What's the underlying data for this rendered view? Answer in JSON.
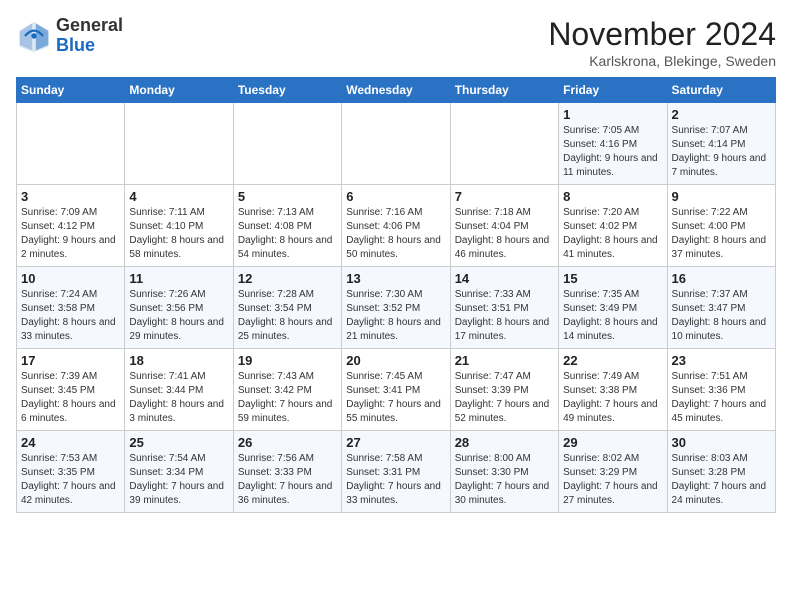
{
  "header": {
    "logo_general": "General",
    "logo_blue": "Blue",
    "title": "November 2024",
    "location": "Karlskrona, Blekinge, Sweden"
  },
  "days_of_week": [
    "Sunday",
    "Monday",
    "Tuesday",
    "Wednesday",
    "Thursday",
    "Friday",
    "Saturday"
  ],
  "weeks": [
    [
      {
        "day": "",
        "info": ""
      },
      {
        "day": "",
        "info": ""
      },
      {
        "day": "",
        "info": ""
      },
      {
        "day": "",
        "info": ""
      },
      {
        "day": "",
        "info": ""
      },
      {
        "day": "1",
        "info": "Sunrise: 7:05 AM\nSunset: 4:16 PM\nDaylight: 9 hours and 11 minutes."
      },
      {
        "day": "2",
        "info": "Sunrise: 7:07 AM\nSunset: 4:14 PM\nDaylight: 9 hours and 7 minutes."
      }
    ],
    [
      {
        "day": "3",
        "info": "Sunrise: 7:09 AM\nSunset: 4:12 PM\nDaylight: 9 hours and 2 minutes."
      },
      {
        "day": "4",
        "info": "Sunrise: 7:11 AM\nSunset: 4:10 PM\nDaylight: 8 hours and 58 minutes."
      },
      {
        "day": "5",
        "info": "Sunrise: 7:13 AM\nSunset: 4:08 PM\nDaylight: 8 hours and 54 minutes."
      },
      {
        "day": "6",
        "info": "Sunrise: 7:16 AM\nSunset: 4:06 PM\nDaylight: 8 hours and 50 minutes."
      },
      {
        "day": "7",
        "info": "Sunrise: 7:18 AM\nSunset: 4:04 PM\nDaylight: 8 hours and 46 minutes."
      },
      {
        "day": "8",
        "info": "Sunrise: 7:20 AM\nSunset: 4:02 PM\nDaylight: 8 hours and 41 minutes."
      },
      {
        "day": "9",
        "info": "Sunrise: 7:22 AM\nSunset: 4:00 PM\nDaylight: 8 hours and 37 minutes."
      }
    ],
    [
      {
        "day": "10",
        "info": "Sunrise: 7:24 AM\nSunset: 3:58 PM\nDaylight: 8 hours and 33 minutes."
      },
      {
        "day": "11",
        "info": "Sunrise: 7:26 AM\nSunset: 3:56 PM\nDaylight: 8 hours and 29 minutes."
      },
      {
        "day": "12",
        "info": "Sunrise: 7:28 AM\nSunset: 3:54 PM\nDaylight: 8 hours and 25 minutes."
      },
      {
        "day": "13",
        "info": "Sunrise: 7:30 AM\nSunset: 3:52 PM\nDaylight: 8 hours and 21 minutes."
      },
      {
        "day": "14",
        "info": "Sunrise: 7:33 AM\nSunset: 3:51 PM\nDaylight: 8 hours and 17 minutes."
      },
      {
        "day": "15",
        "info": "Sunrise: 7:35 AM\nSunset: 3:49 PM\nDaylight: 8 hours and 14 minutes."
      },
      {
        "day": "16",
        "info": "Sunrise: 7:37 AM\nSunset: 3:47 PM\nDaylight: 8 hours and 10 minutes."
      }
    ],
    [
      {
        "day": "17",
        "info": "Sunrise: 7:39 AM\nSunset: 3:45 PM\nDaylight: 8 hours and 6 minutes."
      },
      {
        "day": "18",
        "info": "Sunrise: 7:41 AM\nSunset: 3:44 PM\nDaylight: 8 hours and 3 minutes."
      },
      {
        "day": "19",
        "info": "Sunrise: 7:43 AM\nSunset: 3:42 PM\nDaylight: 7 hours and 59 minutes."
      },
      {
        "day": "20",
        "info": "Sunrise: 7:45 AM\nSunset: 3:41 PM\nDaylight: 7 hours and 55 minutes."
      },
      {
        "day": "21",
        "info": "Sunrise: 7:47 AM\nSunset: 3:39 PM\nDaylight: 7 hours and 52 minutes."
      },
      {
        "day": "22",
        "info": "Sunrise: 7:49 AM\nSunset: 3:38 PM\nDaylight: 7 hours and 49 minutes."
      },
      {
        "day": "23",
        "info": "Sunrise: 7:51 AM\nSunset: 3:36 PM\nDaylight: 7 hours and 45 minutes."
      }
    ],
    [
      {
        "day": "24",
        "info": "Sunrise: 7:53 AM\nSunset: 3:35 PM\nDaylight: 7 hours and 42 minutes."
      },
      {
        "day": "25",
        "info": "Sunrise: 7:54 AM\nSunset: 3:34 PM\nDaylight: 7 hours and 39 minutes."
      },
      {
        "day": "26",
        "info": "Sunrise: 7:56 AM\nSunset: 3:33 PM\nDaylight: 7 hours and 36 minutes."
      },
      {
        "day": "27",
        "info": "Sunrise: 7:58 AM\nSunset: 3:31 PM\nDaylight: 7 hours and 33 minutes."
      },
      {
        "day": "28",
        "info": "Sunrise: 8:00 AM\nSunset: 3:30 PM\nDaylight: 7 hours and 30 minutes."
      },
      {
        "day": "29",
        "info": "Sunrise: 8:02 AM\nSunset: 3:29 PM\nDaylight: 7 hours and 27 minutes."
      },
      {
        "day": "30",
        "info": "Sunrise: 8:03 AM\nSunset: 3:28 PM\nDaylight: 7 hours and 24 minutes."
      }
    ]
  ]
}
